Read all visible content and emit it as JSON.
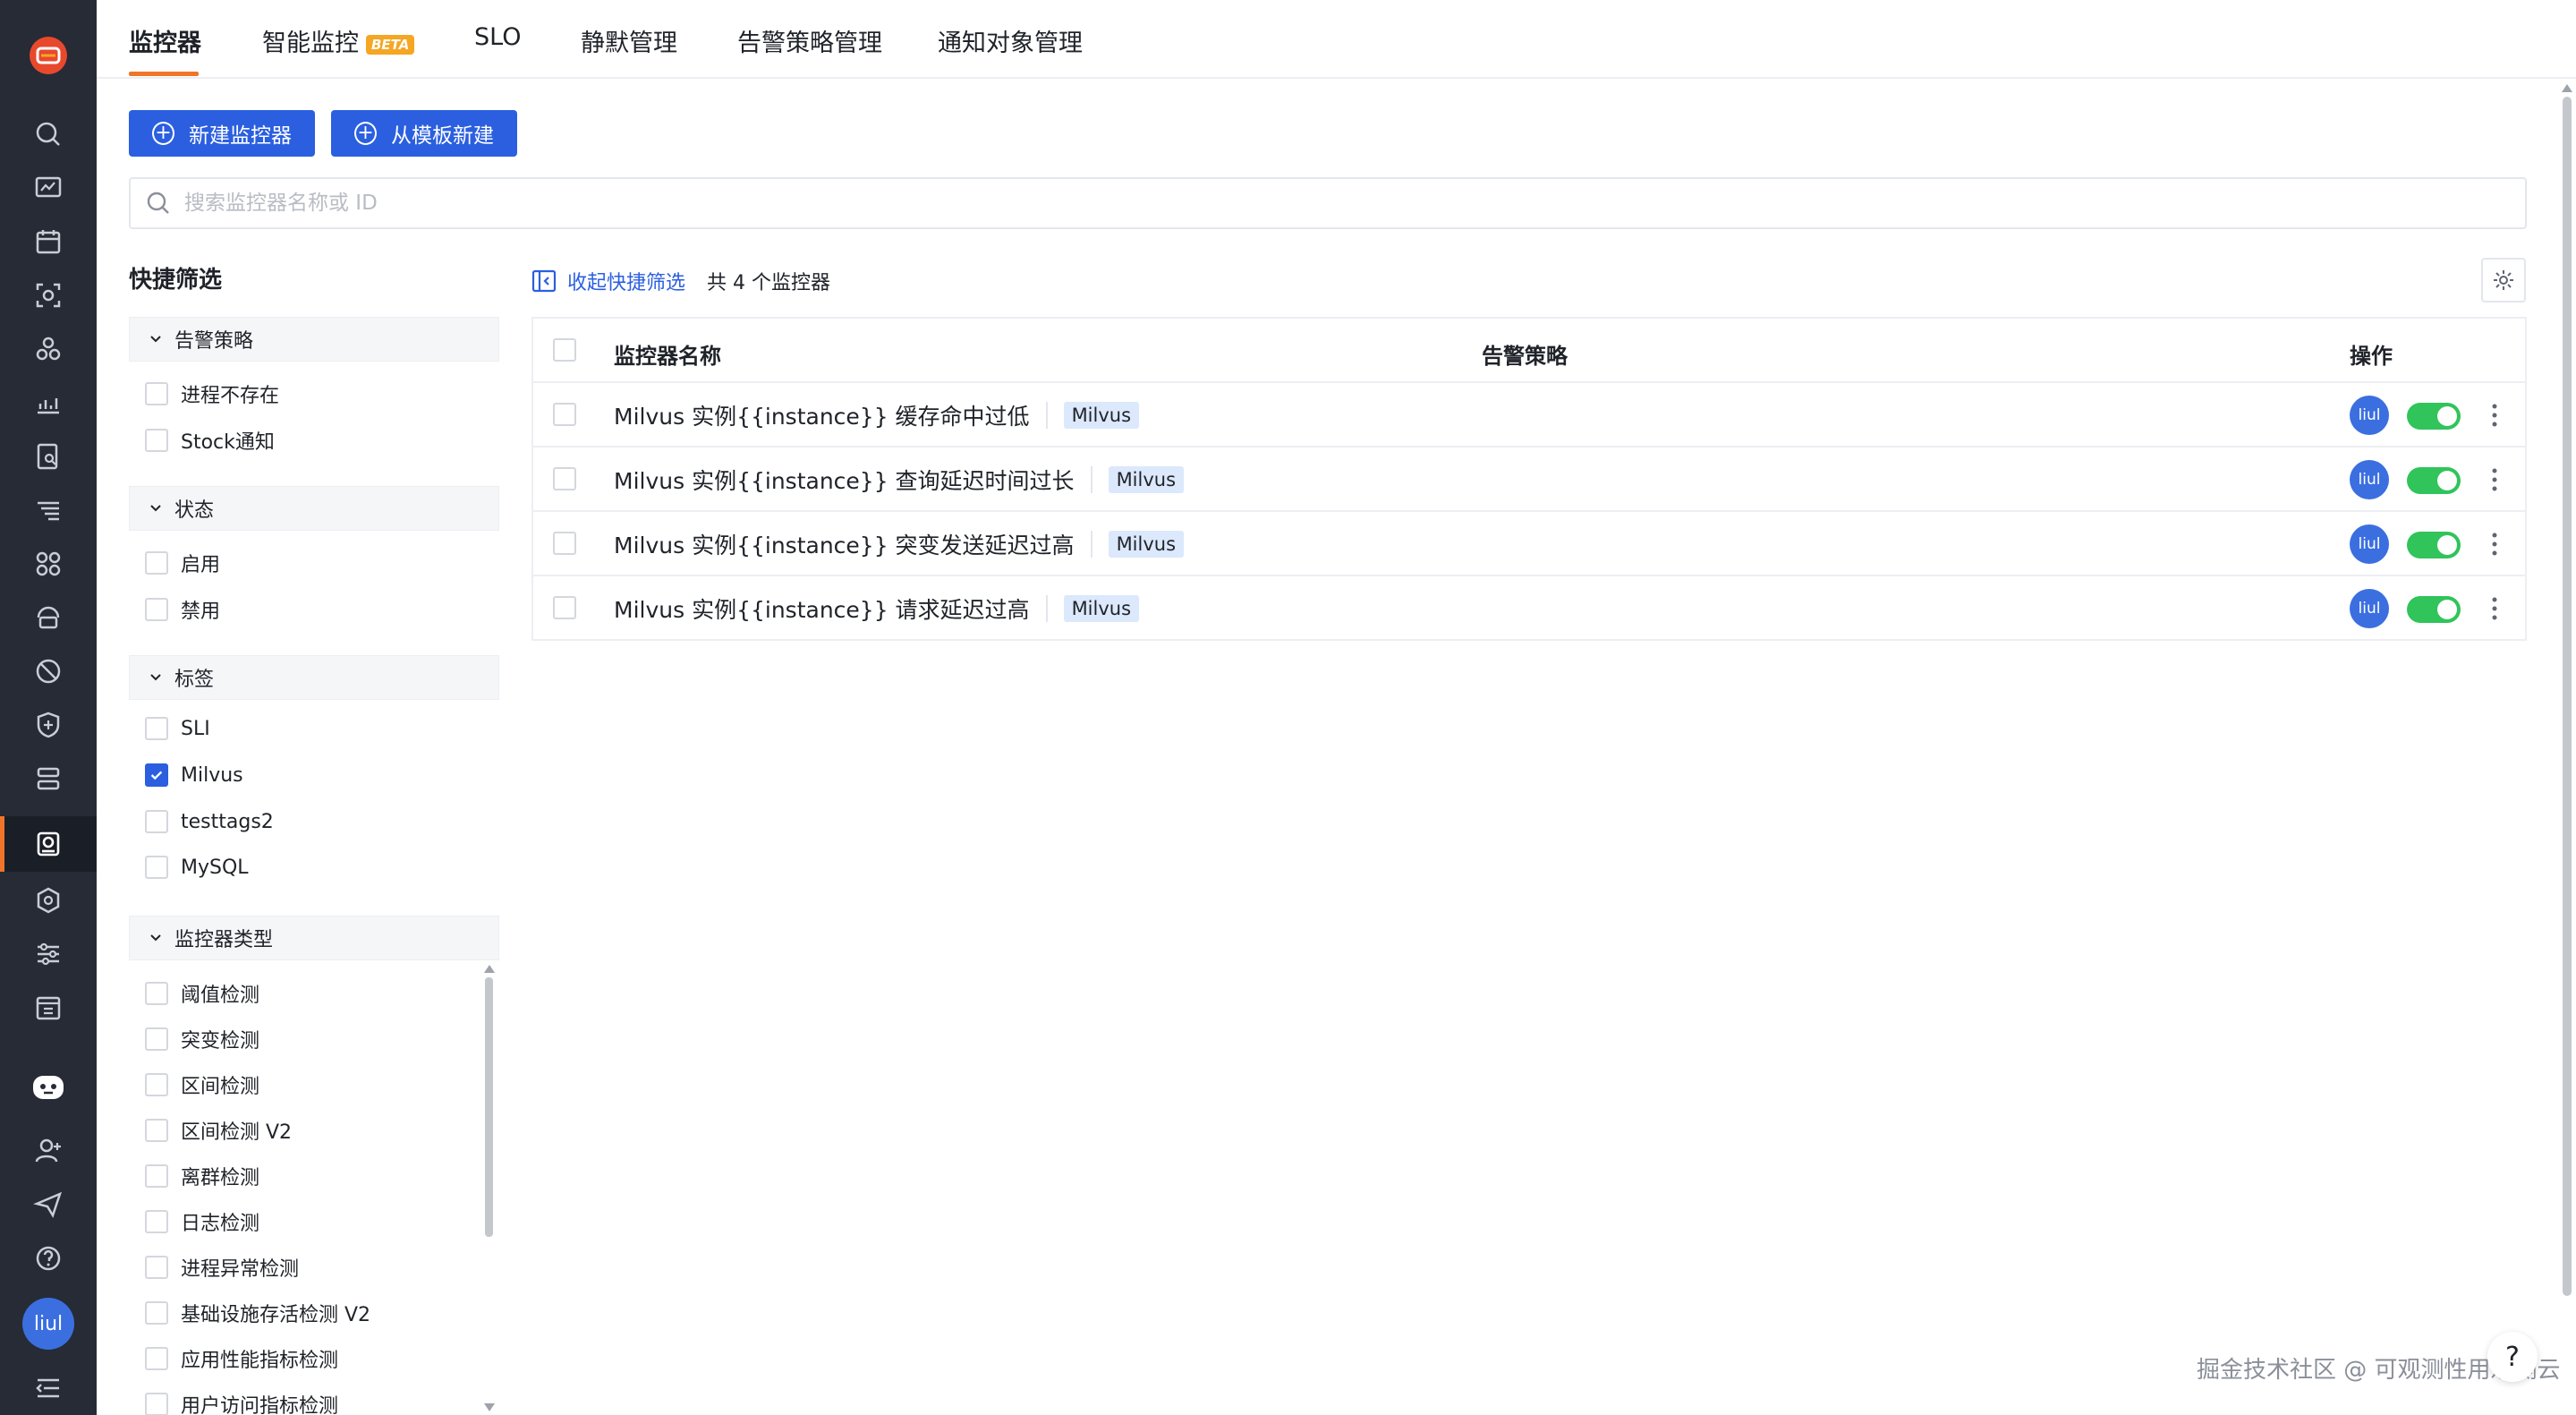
{
  "tabs": [
    {
      "label": "监控器",
      "active": true
    },
    {
      "label": "智能监控",
      "badge": "BETA"
    },
    {
      "label": "SLO"
    },
    {
      "label": "静默管理"
    },
    {
      "label": "告警策略管理"
    },
    {
      "label": "通知对象管理"
    }
  ],
  "actions": {
    "new_monitor": "新建监控器",
    "from_template": "从模板新建"
  },
  "search": {
    "placeholder": "搜索监控器名称或 ID"
  },
  "quick_filter": {
    "title": "快捷筛选",
    "groups": [
      {
        "title": "告警策略",
        "options": [
          {
            "label": "进程不存在",
            "checked": false
          },
          {
            "label": "Stock通知",
            "checked": false
          }
        ]
      },
      {
        "title": "状态",
        "options": [
          {
            "label": "启用",
            "checked": false
          },
          {
            "label": "禁用",
            "checked": false
          }
        ]
      },
      {
        "title": "标签",
        "options": [
          {
            "label": "SLI",
            "checked": false
          },
          {
            "label": "Milvus",
            "checked": true
          },
          {
            "label": "testtags2",
            "checked": false
          },
          {
            "label": "MySQL",
            "checked": false
          }
        ]
      },
      {
        "title": "监控器类型",
        "options": [
          {
            "label": "阈值检测",
            "checked": false
          },
          {
            "label": "突变检测",
            "checked": false
          },
          {
            "label": "区间检测",
            "checked": false
          },
          {
            "label": "区间检测 V2",
            "checked": false
          },
          {
            "label": "离群检测",
            "checked": false
          },
          {
            "label": "日志检测",
            "checked": false
          },
          {
            "label": "进程异常检测",
            "checked": false
          },
          {
            "label": "基础设施存活检测 V2",
            "checked": false
          },
          {
            "label": "应用性能指标检测",
            "checked": false
          },
          {
            "label": "用户访问指标检测",
            "checked": false
          }
        ]
      }
    ]
  },
  "list": {
    "collapse_label": "收起快捷筛选",
    "count_text": "共 4 个监控器",
    "columns": {
      "name": "监控器名称",
      "policy": "告警策略",
      "ops": "操作"
    },
    "rows": [
      {
        "name": "Milvus 实例{{instance}} 缓存命中过低",
        "tag": "Milvus",
        "owner": "liul",
        "enabled": true
      },
      {
        "name": "Milvus 实例{{instance}} 查询延迟时间过长",
        "tag": "Milvus",
        "owner": "liul",
        "enabled": true
      },
      {
        "name": "Milvus 实例{{instance}} 突变发送延迟过高",
        "tag": "Milvus",
        "owner": "liul",
        "enabled": true
      },
      {
        "name": "Milvus 实例{{instance}} 请求延迟过高",
        "tag": "Milvus",
        "owner": "liul",
        "enabled": true
      }
    ]
  },
  "user": {
    "avatar_text": "liul"
  },
  "watermark": "掘金技术社区 @ 可观测性用观测云",
  "help_label": "?",
  "colors": {
    "accent": "#f0752b",
    "primary": "#2b5fe0",
    "sidebar": "#262b36",
    "toggle_on": "#30c45a",
    "tag_bg": "#dce8fb"
  }
}
